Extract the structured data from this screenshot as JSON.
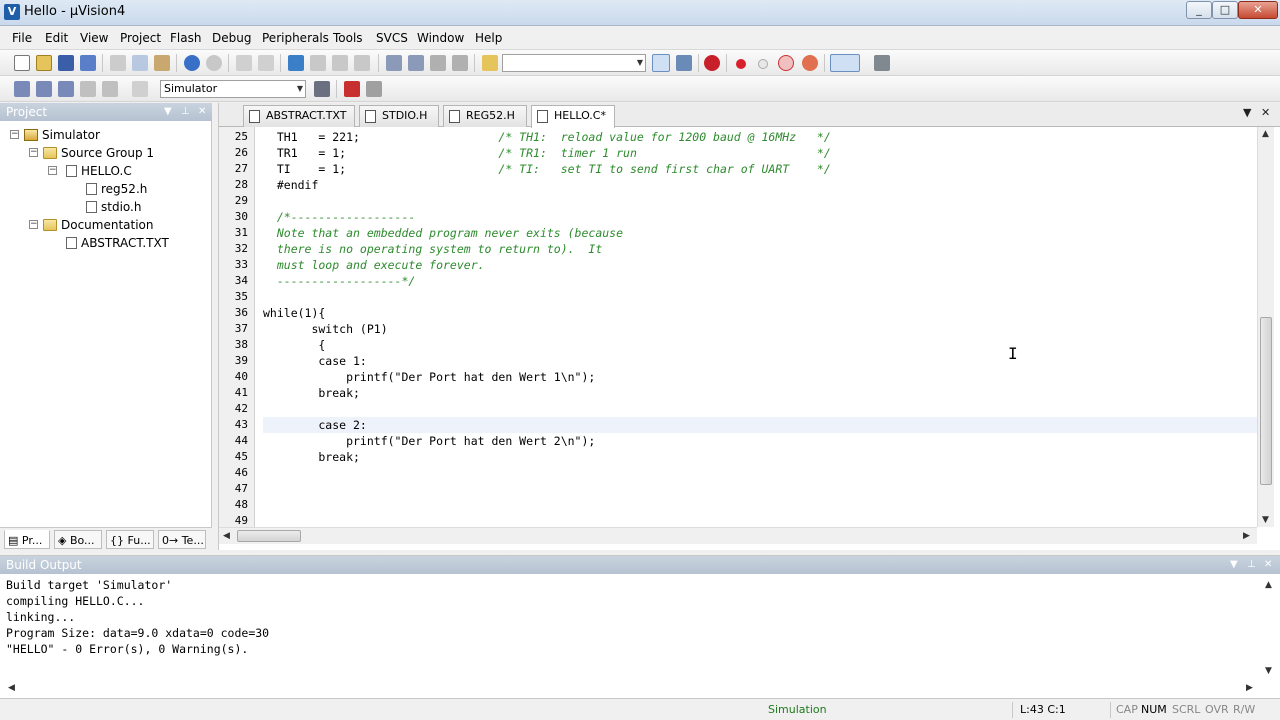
{
  "window": {
    "app_icon": "V",
    "title": "Hello - µVision4",
    "controls": [
      "_",
      "□",
      "✕"
    ]
  },
  "menu": [
    "File",
    "Edit",
    "View",
    "Project",
    "Flash",
    "Debug",
    "Peripherals",
    "Tools",
    "SVCS",
    "Window",
    "Help"
  ],
  "toolbar2": {
    "target_combo": "Simulator"
  },
  "project_panel": {
    "title": "Project",
    "tree": [
      {
        "label": "Simulator",
        "level": 0,
        "type": "target",
        "expander": "−"
      },
      {
        "label": "Source Group 1",
        "level": 1,
        "type": "folder",
        "expander": "−"
      },
      {
        "label": "HELLO.C",
        "level": 2,
        "type": "file",
        "expander": "−"
      },
      {
        "label": "reg52.h",
        "level": 3,
        "type": "file",
        "expander": ""
      },
      {
        "label": "stdio.h",
        "level": 3,
        "type": "file",
        "expander": ""
      },
      {
        "label": "Documentation",
        "level": 1,
        "type": "folder",
        "expander": "−"
      },
      {
        "label": "ABSTRACT.TXT",
        "level": 2,
        "type": "file",
        "expander": ""
      }
    ],
    "tabs": [
      {
        "label": "Pr...",
        "icon": "project-icon"
      },
      {
        "label": "Bo...",
        "icon": "books-icon"
      },
      {
        "label": "{} Fu...",
        "icon": "functions-icon"
      },
      {
        "label": "0→ Te...",
        "icon": "templates-icon"
      }
    ]
  },
  "editor": {
    "tabs": [
      {
        "label": "ABSTRACT.TXT",
        "active": false
      },
      {
        "label": "STDIO.H",
        "active": false
      },
      {
        "label": "REG52.H",
        "active": false
      },
      {
        "label": "HELLO.C*",
        "active": true
      }
    ],
    "current_line": 43,
    "lines": [
      {
        "n": "25",
        "code": "  TH1   = 221;",
        "comment": "                    /* TH1:  reload value for 1200 baud @ 16MHz   */"
      },
      {
        "n": "26",
        "code": "  TR1   = 1;",
        "comment": "                      /* TR1:  timer 1 run                          */"
      },
      {
        "n": "27",
        "code": "  TI    = 1;",
        "comment": "                      /* TI:   set TI to send first char of UART    */"
      },
      {
        "n": "28",
        "code": "  #endif",
        "comment": ""
      },
      {
        "n": "29",
        "code": "",
        "comment": ""
      },
      {
        "n": "30",
        "code": "",
        "comment": "  /*------------------"
      },
      {
        "n": "31",
        "code": "",
        "comment": "  Note that an embedded program never exits (because"
      },
      {
        "n": "32",
        "code": "",
        "comment": "  there is no operating system to return to).  It"
      },
      {
        "n": "33",
        "code": "",
        "comment": "  must loop and execute forever."
      },
      {
        "n": "34",
        "code": "",
        "comment": "  ------------------*/"
      },
      {
        "n": "35",
        "code": "",
        "comment": ""
      },
      {
        "n": "36",
        "code": "while(1){",
        "comment": ""
      },
      {
        "n": "37",
        "code": "       switch (P1)",
        "comment": ""
      },
      {
        "n": "38",
        "code": "        {",
        "comment": ""
      },
      {
        "n": "39",
        "code": "        case 1:",
        "comment": ""
      },
      {
        "n": "40",
        "code": "            printf(\"Der Port hat den Wert 1\\n\");",
        "comment": ""
      },
      {
        "n": "41",
        "code": "        break;",
        "comment": ""
      },
      {
        "n": "42",
        "code": "",
        "comment": ""
      },
      {
        "n": "43",
        "code": "        case 2:",
        "comment": ""
      },
      {
        "n": "44",
        "code": "            printf(\"Der Port hat den Wert 2\\n\");",
        "comment": ""
      },
      {
        "n": "45",
        "code": "        break;",
        "comment": ""
      },
      {
        "n": "46",
        "code": "",
        "comment": ""
      },
      {
        "n": "47",
        "code": "",
        "comment": ""
      },
      {
        "n": "48",
        "code": "",
        "comment": ""
      },
      {
        "n": "49",
        "code": "",
        "comment": ""
      }
    ]
  },
  "build_output": {
    "title": "Build Output",
    "lines": [
      "Build target 'Simulator'",
      "compiling HELLO.C...",
      "linking...",
      "Program Size: data=9.0 xdata=0 code=30",
      "\"HELLO\" - 0 Error(s), 0 Warning(s)."
    ]
  },
  "status": {
    "mode": "Simulation",
    "position": "L:43 C:1",
    "cap": "CAP",
    "num": "NUM",
    "scrl": "SCRL",
    "ovr": "OVR",
    "rw": "R/W"
  },
  "colors": {
    "comment": "#2e8b2e",
    "number": "#7a3a00",
    "current_line": "#eef2fa",
    "panel_header": "#b6c2d1"
  }
}
